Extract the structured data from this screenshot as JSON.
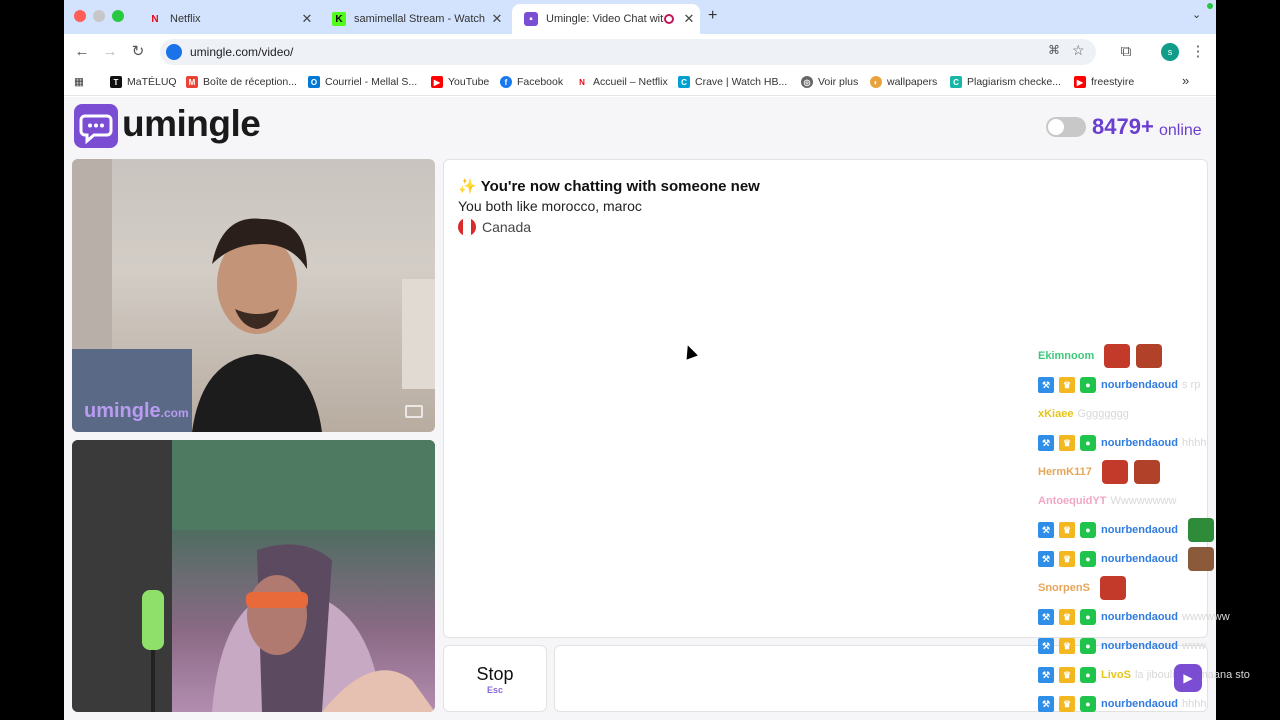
{
  "tabs": [
    {
      "title": "Netflix",
      "icon": "netflix-icon"
    },
    {
      "title": "samimellal Stream - Watch Li",
      "icon": "kick-icon"
    },
    {
      "title": "Umingle: Video Chat with",
      "icon": "umingle-icon"
    }
  ],
  "url": "umingle.com/video/",
  "profile_initial": "s",
  "bookmarks": [
    "MaTÉLUQ",
    "Boîte de réception...",
    "Courriel - Mellal S...",
    "YouTube",
    "Facebook",
    "Accueil – Netflix",
    "Crave | Watch HB...",
    "Voir plus",
    "wallpapers",
    "Plagiarism checke...",
    "freestyire"
  ],
  "site": {
    "logo": "umingle",
    "online_count": "8479+",
    "online_label": "online",
    "watermark": "umingle",
    "watermark_suffix": ".com"
  },
  "chat": {
    "sparkle": "✨",
    "title": "You're now chatting with someone new",
    "common": "You both like morocco, maroc",
    "country": "Canada"
  },
  "stop": {
    "label": "Stop",
    "key": "Esc"
  },
  "overlay_chat": [
    {
      "user": "Ekimnoom",
      "text": "",
      "color": "#3ec97a",
      "badges": false,
      "emotes": 2
    },
    {
      "user": "nourbendaoud",
      "text": "s rp",
      "color": "#2f7de1",
      "badges": true,
      "emotes": 0
    },
    {
      "user": "xKiaee",
      "text": "Gggggggg",
      "color": "#e5c51a",
      "badges": false,
      "emotes": 0
    },
    {
      "user": "nourbendaoud",
      "text": "hhhh",
      "color": "#2f7de1",
      "badges": true,
      "emotes": 0
    },
    {
      "user": "HermK117",
      "text": "",
      "color": "#e5a65a",
      "badges": false,
      "emotes": 2
    },
    {
      "user": "AntoequidYT",
      "text": "Wwwwwwww",
      "color": "#f2a7c4",
      "badges": false,
      "emotes": 0
    },
    {
      "user": "nourbendaoud",
      "text": "",
      "color": "#2f7de1",
      "badges": true,
      "emotes": 1
    },
    {
      "user": "nourbendaoud",
      "text": "",
      "color": "#2f7de1",
      "badges": true,
      "emotes": 1
    },
    {
      "user": "SnorpenS",
      "text": "",
      "color": "#e5a65a",
      "badges": false,
      "emotes": 1
    },
    {
      "user": "nourbendaoud",
      "text": "wwwwww",
      "color": "#2f7de1",
      "badges": true,
      "emotes": 0
    },
    {
      "user": "nourbendaoud",
      "text": "www",
      "color": "#2f7de1",
      "badges": true,
      "emotes": 0
    },
    {
      "user": "LivoS",
      "text": "la jibouliahal maana sto",
      "color": "#e5c51a",
      "badges": true,
      "emotes": 0
    },
    {
      "user": "nourbendaoud",
      "text": "hhhh",
      "color": "#2f7de1",
      "badges": true,
      "emotes": 0
    }
  ]
}
